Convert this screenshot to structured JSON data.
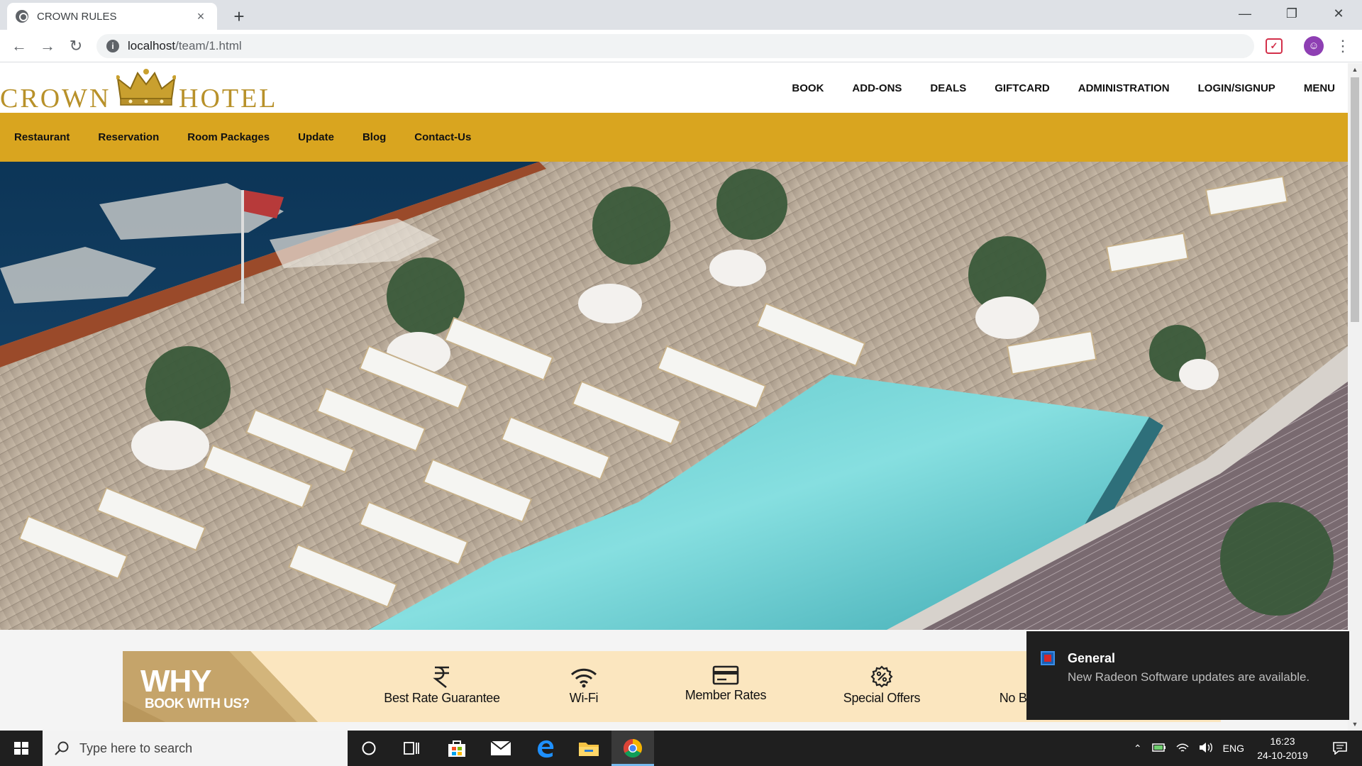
{
  "browser": {
    "tab_title": "CROWN RULES",
    "tab_close": "×",
    "new_tab": "+",
    "window_controls": [
      "—",
      "❐",
      "✕"
    ],
    "url_host": "localhost",
    "url_path": "/team/1.html",
    "back": "←",
    "forward": "→",
    "reload": "↻"
  },
  "site": {
    "logo_left": "CROWN",
    "logo_right": "HOTEL",
    "top_nav": [
      "BOOK",
      "ADD-ONS",
      "DEALS",
      "GIFTCARD",
      "ADMINISTRATION",
      "LOGIN/SIGNUP",
      "MENU"
    ],
    "sub_nav": [
      "Restaurant",
      "Reservation",
      "Room Packages",
      "Update",
      "Blog",
      "Contact-Us"
    ],
    "why": {
      "title": "WHY",
      "subtitle": "BOOK WITH US?",
      "features": [
        {
          "label": "Best Rate Guarantee",
          "icon": "rupee-icon"
        },
        {
          "label": "Wi-Fi",
          "icon": "wifi-icon"
        },
        {
          "label": "Member Rates",
          "icon": "card-icon"
        },
        {
          "label": "Special Offers",
          "icon": "discount-icon"
        },
        {
          "label": "No Bo",
          "icon": "none"
        }
      ]
    }
  },
  "toast": {
    "title": "General",
    "body": "New Radeon Software updates are available."
  },
  "taskbar": {
    "search_placeholder": "Type here to search",
    "language": "ENG",
    "time": "16:23",
    "date": "24-10-2019"
  },
  "colors": {
    "gold": "#d9a51f",
    "logo_gold": "#b8912a",
    "why_bg": "#fbe6bf"
  }
}
